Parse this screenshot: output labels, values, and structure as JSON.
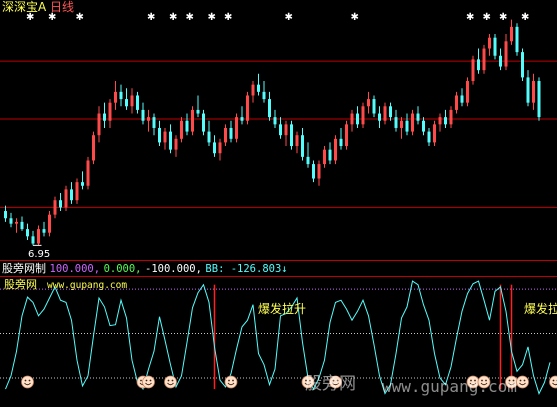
{
  "colors": {
    "up": "#ff4a4a",
    "down": "#54fcfc",
    "text_white": "#ffffff",
    "title_yellow": "#ffff54",
    "title_red": "#ff5454",
    "val_purple": "#cc66ff",
    "val_green": "#54fc54",
    "val_yellow": "#ffff54",
    "indicator_line": "#54fcfc",
    "dotted_purple": "#cc66ff",
    "dotted_white": "#c8c8c8",
    "red_grid": "#c00000",
    "smile": "#ffe0c8"
  },
  "title_bar": {
    "app": "深深宝A",
    "period": "日线"
  },
  "indicator_header": {
    "name": "股旁网制",
    "v1": "100.000,",
    "v2": "0.000,",
    "v3": "-100.000,",
    "bb": "BB: -126.803↓"
  },
  "site": {
    "label": "股旁网",
    "url": "www.gupang.com"
  },
  "signals": {
    "tag1": "爆发拉升",
    "tag2": "爆发拉升"
  },
  "watermark": {
    "cn": "股旁网",
    "url": "www.gupang.com"
  },
  "price_low_label": "6.95",
  "chart_data": {
    "type": "candlestick",
    "title": "",
    "xlabel": "",
    "ylabel": "",
    "ylim": [
      6.6,
      13.3
    ],
    "reference_lines": [
      8.0,
      10.45,
      12.05
    ],
    "low_annotation": 6.95,
    "ohlc": [
      [
        7.9,
        8.05,
        7.6,
        7.7
      ],
      [
        7.7,
        7.85,
        7.45,
        7.55
      ],
      [
        7.55,
        7.7,
        7.3,
        7.6
      ],
      [
        7.6,
        7.75,
        7.35,
        7.4
      ],
      [
        7.4,
        7.55,
        7.1,
        7.2
      ],
      [
        7.2,
        7.35,
        6.95,
        7.0
      ],
      [
        7.0,
        7.5,
        6.95,
        7.4
      ],
      [
        7.4,
        7.6,
        7.2,
        7.3
      ],
      [
        7.3,
        7.9,
        7.2,
        7.8
      ],
      [
        7.8,
        8.3,
        7.7,
        8.2
      ],
      [
        8.2,
        8.4,
        7.9,
        8.0
      ],
      [
        8.0,
        8.6,
        7.9,
        8.5
      ],
      [
        8.5,
        8.7,
        8.1,
        8.2
      ],
      [
        8.2,
        8.8,
        8.1,
        8.7
      ],
      [
        8.7,
        9.0,
        8.5,
        8.6
      ],
      [
        8.6,
        9.4,
        8.5,
        9.3
      ],
      [
        9.3,
        10.1,
        9.2,
        10.0
      ],
      [
        10.0,
        10.8,
        9.8,
        10.6
      ],
      [
        10.6,
        10.9,
        10.2,
        10.4
      ],
      [
        10.4,
        11.0,
        10.2,
        10.9
      ],
      [
        10.9,
        11.5,
        10.7,
        11.2
      ],
      [
        11.2,
        11.4,
        10.8,
        11.0
      ],
      [
        11.0,
        11.3,
        10.7,
        10.8
      ],
      [
        10.8,
        11.3,
        10.6,
        11.1
      ],
      [
        11.1,
        11.2,
        10.6,
        10.7
      ],
      [
        10.7,
        10.9,
        10.3,
        10.4
      ],
      [
        10.4,
        10.7,
        10.1,
        10.5
      ],
      [
        10.5,
        10.6,
        10.0,
        10.2
      ],
      [
        10.2,
        10.4,
        9.7,
        9.8
      ],
      [
        9.8,
        10.2,
        9.6,
        10.1
      ],
      [
        10.1,
        10.3,
        9.5,
        9.6
      ],
      [
        9.6,
        10.0,
        9.4,
        9.9
      ],
      [
        9.9,
        10.5,
        9.8,
        10.4
      ],
      [
        10.4,
        10.6,
        10.0,
        10.1
      ],
      [
        10.1,
        10.8,
        10.0,
        10.7
      ],
      [
        10.7,
        11.1,
        10.5,
        10.6
      ],
      [
        10.6,
        10.7,
        10.0,
        10.1
      ],
      [
        10.1,
        10.4,
        9.7,
        9.8
      ],
      [
        9.8,
        10.0,
        9.4,
        9.5
      ],
      [
        9.5,
        9.9,
        9.3,
        9.8
      ],
      [
        9.8,
        10.3,
        9.7,
        10.2
      ],
      [
        10.2,
        10.4,
        9.8,
        9.9
      ],
      [
        9.9,
        10.6,
        9.8,
        10.5
      ],
      [
        10.5,
        10.8,
        10.3,
        10.4
      ],
      [
        10.4,
        11.2,
        10.3,
        11.1
      ],
      [
        11.1,
        11.5,
        10.9,
        11.4
      ],
      [
        11.4,
        11.7,
        11.1,
        11.2
      ],
      [
        11.2,
        11.5,
        10.9,
        11.0
      ],
      [
        11.0,
        11.2,
        10.4,
        10.5
      ],
      [
        10.5,
        10.7,
        10.2,
        10.3
      ],
      [
        10.3,
        10.5,
        9.9,
        10.0
      ],
      [
        10.0,
        10.4,
        9.7,
        10.3
      ],
      [
        10.3,
        10.4,
        9.6,
        9.7
      ],
      [
        9.7,
        10.1,
        9.5,
        10.0
      ],
      [
        10.0,
        10.2,
        9.3,
        9.4
      ],
      [
        9.4,
        9.8,
        9.1,
        9.2
      ],
      [
        9.2,
        9.3,
        8.7,
        8.8
      ],
      [
        8.8,
        9.3,
        8.6,
        9.2
      ],
      [
        9.2,
        9.7,
        9.1,
        9.6
      ],
      [
        9.6,
        9.8,
        9.2,
        9.3
      ],
      [
        9.3,
        10.0,
        9.2,
        9.9
      ],
      [
        9.9,
        10.2,
        9.6,
        9.7
      ],
      [
        9.7,
        10.4,
        9.6,
        10.3
      ],
      [
        10.3,
        10.7,
        10.1,
        10.6
      ],
      [
        10.6,
        10.8,
        10.2,
        10.3
      ],
      [
        10.3,
        10.9,
        10.2,
        10.8
      ],
      [
        10.8,
        11.2,
        10.6,
        11.0
      ],
      [
        11.0,
        11.1,
        10.5,
        10.6
      ],
      [
        10.6,
        10.8,
        10.2,
        10.4
      ],
      [
        10.4,
        10.9,
        10.3,
        10.8
      ],
      [
        10.8,
        10.9,
        10.4,
        10.5
      ],
      [
        10.5,
        10.7,
        10.1,
        10.2
      ],
      [
        10.2,
        10.5,
        9.9,
        10.4
      ],
      [
        10.4,
        10.6,
        10.0,
        10.1
      ],
      [
        10.1,
        10.7,
        10.0,
        10.6
      ],
      [
        10.6,
        10.8,
        10.3,
        10.4
      ],
      [
        10.4,
        10.5,
        10.0,
        10.1
      ],
      [
        10.1,
        10.2,
        9.7,
        9.8
      ],
      [
        9.8,
        10.4,
        9.7,
        10.3
      ],
      [
        10.3,
        10.6,
        10.1,
        10.5
      ],
      [
        10.5,
        10.7,
        10.2,
        10.3
      ],
      [
        10.3,
        10.8,
        10.2,
        10.7
      ],
      [
        10.7,
        11.2,
        10.6,
        11.1
      ],
      [
        11.1,
        11.3,
        10.8,
        10.9
      ],
      [
        10.9,
        11.6,
        10.8,
        11.5
      ],
      [
        11.5,
        12.2,
        11.4,
        12.1
      ],
      [
        12.1,
        12.4,
        11.7,
        11.8
      ],
      [
        11.8,
        12.5,
        11.7,
        12.4
      ],
      [
        12.4,
        12.8,
        12.2,
        12.7
      ],
      [
        12.7,
        12.8,
        12.1,
        12.2
      ],
      [
        12.2,
        12.4,
        11.8,
        11.9
      ],
      [
        11.9,
        12.8,
        11.8,
        12.6
      ],
      [
        12.6,
        13.2,
        12.5,
        13.0
      ],
      [
        13.0,
        13.1,
        12.2,
        12.3
      ],
      [
        12.3,
        12.4,
        11.5,
        11.6
      ],
      [
        11.6,
        11.8,
        10.8,
        10.9
      ],
      [
        10.9,
        11.7,
        10.7,
        11.5
      ],
      [
        11.5,
        11.6,
        10.4,
        10.5
      ]
    ],
    "indicator": {
      "name": "股旁网制",
      "levels": [
        100,
        0,
        -100
      ],
      "bb": -126.803,
      "ylim": [
        -145,
        125
      ],
      "values": [
        -125,
        -95,
        -40,
        40,
        82,
        70,
        40,
        55,
        80,
        105,
        75,
        70,
        30,
        -60,
        -118,
        -95,
        -5,
        80,
        60,
        18,
        20,
        75,
        35,
        -60,
        -110,
        -125,
        -80,
        -40,
        38,
        -15,
        -70,
        -120,
        -95,
        -20,
        58,
        92,
        110,
        70,
        -30,
        -105,
        -120,
        -90,
        -35,
        15,
        30,
        65,
        -45,
        -70,
        -115,
        -80,
        40,
        45,
        60,
        80,
        -20,
        -100,
        -125,
        -100,
        -60,
        25,
        70,
        75,
        55,
        30,
        50,
        75,
        40,
        -25,
        -95,
        -135,
        -115,
        -45,
        35,
        60,
        118,
        110,
        65,
        30,
        -45,
        -100,
        -115,
        -75,
        -10,
        50,
        90,
        112,
        118,
        75,
        30,
        95,
        105,
        50,
        -40,
        -85,
        -70,
        -30,
        -95,
        -135,
        -110,
        -65
      ]
    },
    "signal_bars": [
      {
        "index": 38,
        "label": "爆发拉升"
      },
      {
        "index": 90,
        "label": "爆发拉升"
      },
      {
        "index": 92,
        "label": ""
      }
    ],
    "smiley_markers": [
      4,
      25,
      26,
      30,
      41,
      55,
      60,
      85,
      87,
      92,
      94,
      100
    ]
  }
}
